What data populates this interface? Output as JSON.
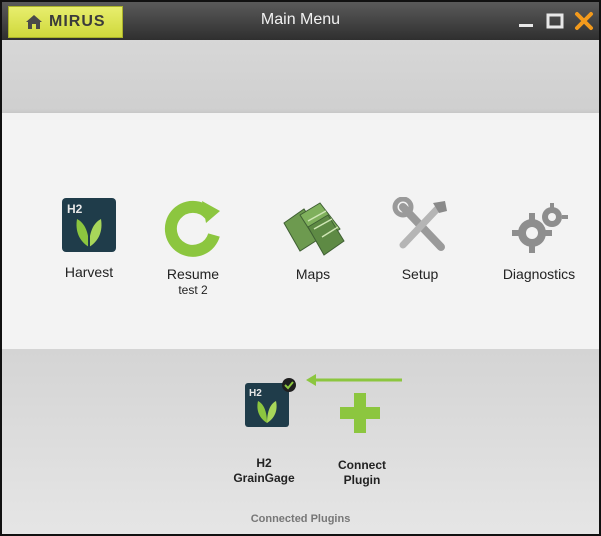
{
  "titlebar": {
    "brand": "MIRUS",
    "title": "Main Menu"
  },
  "menu": {
    "items": [
      {
        "label": "Harvest",
        "icon": "h2-harvest-icon"
      },
      {
        "label": "Resume",
        "sublabel": "test 2",
        "icon": "resume-icon"
      },
      {
        "label": "Maps",
        "icon": "maps-icon"
      },
      {
        "label": "Setup",
        "icon": "setup-tools-icon"
      },
      {
        "label": "Diagnostics",
        "icon": "gears-icon"
      }
    ]
  },
  "plugins": {
    "h2": {
      "line1": "H2",
      "line2": "GrainGage"
    },
    "connect": {
      "line1": "Connect",
      "line2": "Plugin"
    },
    "footer": "Connected Plugins"
  },
  "colors": {
    "brand": "#d4dc3e",
    "accent_green": "#8cc63f",
    "close": "#f39a1c"
  }
}
